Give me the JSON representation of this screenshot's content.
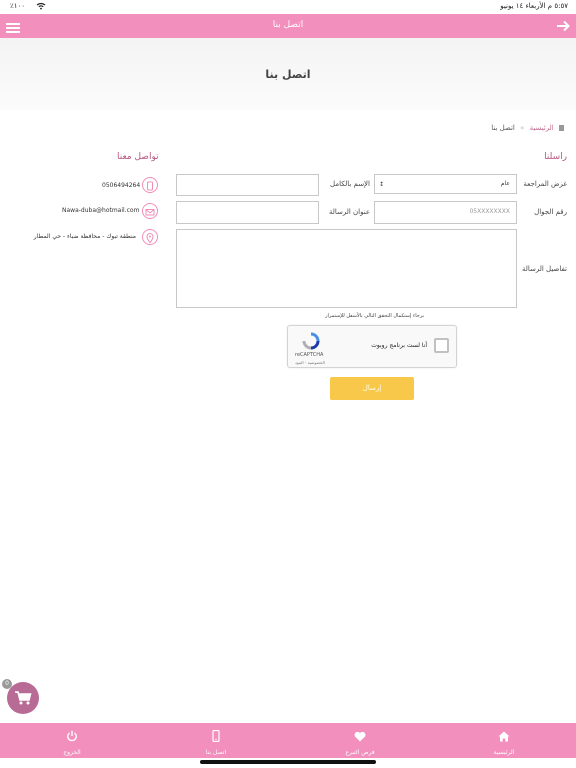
{
  "status_bar": {
    "time": "٥:٥٧ م   الأربعاء ١٤ يونيو",
    "battery": "٪١٠٠"
  },
  "nav": {
    "title": "اتصل بنا"
  },
  "hero": {
    "title": "اتصل بنا"
  },
  "breadcrumb": {
    "home": "الرئيسية",
    "separator": "»",
    "current": "اتصل بنا"
  },
  "form": {
    "section_title": "راسلنا",
    "purpose_label": "غرض المراجعة",
    "purpose_value": "عام",
    "name_label": "الإسم بالكامل",
    "phone_label": "رقم الجوال",
    "phone_placeholder": "05XXXXXXXX",
    "subject_label": "عنوان الرسالة",
    "details_label": "تفاصيل الرسالة",
    "captcha_hint": "برجاء إستكمال التحقق التالي بالأسفل للإستمرار",
    "captcha_label": "أنا لست برنامج روبوت",
    "captcha_brand": "reCAPTCHA",
    "captcha_terms": "الخصوصية - البنود",
    "submit_label": "إرسال"
  },
  "contact": {
    "section_title": "تواصل معنا",
    "phone": "0506494264",
    "email": "Nawa-duba@hotmail.com",
    "address": "منطقة تبوك - محافظة ضباء - حي المطار"
  },
  "cart": {
    "badge": "0"
  },
  "tabs": [
    {
      "label": "الرئيسية",
      "icon": "home-icon"
    },
    {
      "label": "فرص التبرع",
      "icon": "heart-icon"
    },
    {
      "label": "اتصل بنا",
      "icon": "mobile-icon"
    },
    {
      "label": "الخروج",
      "icon": "power-icon"
    }
  ],
  "colors": {
    "accent": "#f28fbd",
    "submit": "#f7c84a",
    "cart": "#b86b95"
  }
}
